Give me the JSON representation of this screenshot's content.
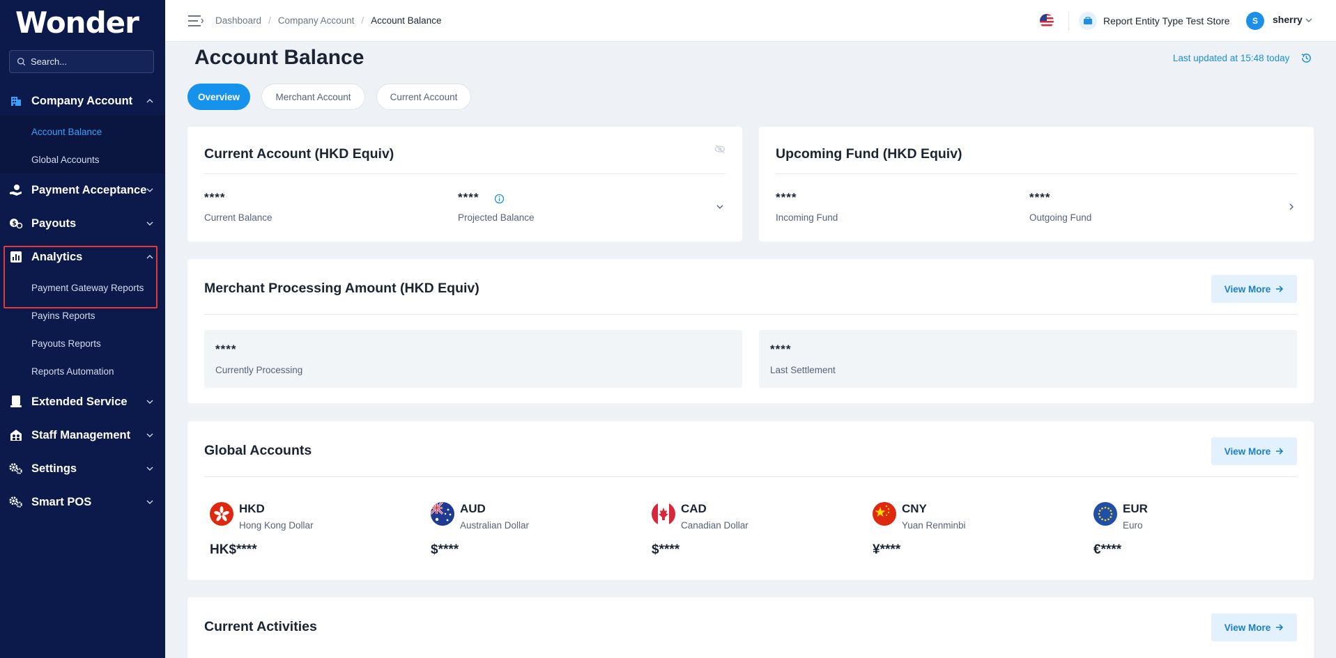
{
  "app": {
    "logo": "Wonder"
  },
  "search": {
    "placeholder": "Search..."
  },
  "sidebar": {
    "groups": [
      {
        "label": "Company Account",
        "icon": "building-icon",
        "expanded": true
      },
      {
        "label": "Payment Acceptance",
        "icon": "hand-coin-icon",
        "expanded": false
      },
      {
        "label": "Payouts",
        "icon": "payouts-icon",
        "expanded": false
      },
      {
        "label": "Analytics",
        "icon": "chart-icon",
        "expanded": true
      },
      {
        "label": "Extended Service",
        "icon": "extended-service-icon",
        "expanded": false
      },
      {
        "label": "Staff Management",
        "icon": "staff-icon",
        "expanded": false
      },
      {
        "label": "Settings",
        "icon": "gears-icon",
        "expanded": false
      },
      {
        "label": "Smart POS",
        "icon": "pos-gears-icon",
        "expanded": false
      }
    ],
    "company_sub": [
      "Account Balance",
      "Global Accounts"
    ],
    "analytics_sub": [
      "Payment Gateway Reports",
      "Payins Reports",
      "Payouts Reports",
      "Reports Automation"
    ]
  },
  "breadcrumb": [
    "Dashboard",
    "Company Account",
    "Account Balance"
  ],
  "header": {
    "store": "Report Entity Type Test Store",
    "avatar_initial": "S",
    "username": "sherry"
  },
  "page": {
    "title": "Account Balance",
    "last_updated": "Last updated at 15:48 today"
  },
  "tabs": [
    "Overview",
    "Merchant Account",
    "Current Account"
  ],
  "current_account": {
    "title": "Current Account (HKD Equiv)",
    "current_value": "****",
    "current_label": "Current Balance",
    "projected_value": "****",
    "projected_label": "Projected Balance"
  },
  "upcoming_fund": {
    "title": "Upcoming Fund (HKD Equiv)",
    "incoming_value": "****",
    "incoming_label": "Incoming Fund",
    "outgoing_value": "****",
    "outgoing_label": "Outgoing Fund"
  },
  "merchant_processing": {
    "title": "Merchant Processing Amount (HKD Equiv)",
    "view_more": "View More",
    "processing_value": "****",
    "processing_label": "Currently Processing",
    "settlement_value": "****",
    "settlement_label": "Last Settlement"
  },
  "global_accounts": {
    "title": "Global Accounts",
    "view_more": "View More",
    "currencies": [
      {
        "code": "HKD",
        "name": "Hong Kong Dollar",
        "amount": "HK$****",
        "flag": "hk-flag-icon"
      },
      {
        "code": "AUD",
        "name": "Australian Dollar",
        "amount": "$****",
        "flag": "au-flag-icon"
      },
      {
        "code": "CAD",
        "name": "Canadian Dollar",
        "amount": "$****",
        "flag": "ca-flag-icon"
      },
      {
        "code": "CNY",
        "name": "Yuan Renminbi",
        "amount": "¥****",
        "flag": "cn-flag-icon"
      },
      {
        "code": "EUR",
        "name": "Euro",
        "amount": "€****",
        "flag": "eu-flag-icon"
      }
    ]
  },
  "current_activities": {
    "title": "Current Activities",
    "view_more": "View More"
  },
  "colors": {
    "sidebar": "#0c1a4b",
    "accent": "#1592ec",
    "highlight": "#e53935"
  }
}
